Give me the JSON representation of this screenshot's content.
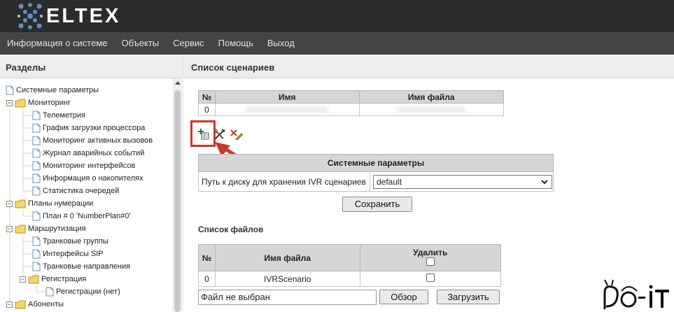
{
  "header": {
    "brand": "ELTEX"
  },
  "menu": [
    "Информация о системе",
    "Объекты",
    "Сервис",
    "Помощь",
    "Выход"
  ],
  "sidebar": {
    "title": "Разделы",
    "tree": [
      {
        "label": "Системные параметры",
        "type": "doc",
        "level": 0
      },
      {
        "label": "Мониторинг",
        "type": "folder",
        "level": 0
      },
      {
        "label": "Телеметрия",
        "type": "doc",
        "level": 1
      },
      {
        "label": "График загрузки процессора",
        "type": "doc",
        "level": 1
      },
      {
        "label": "Мониторинг активных вызовов",
        "type": "doc",
        "level": 1
      },
      {
        "label": "Журнал аварийных событий",
        "type": "doc",
        "level": 1
      },
      {
        "label": "Мониторинг интерфейсов",
        "type": "doc",
        "level": 1
      },
      {
        "label": "Информация о накопителях",
        "type": "doc",
        "level": 1
      },
      {
        "label": "Статистика очередей",
        "type": "doc",
        "level": 1
      },
      {
        "label": "Планы нумерации",
        "type": "folder",
        "level": 0
      },
      {
        "label": "План # 0 'NumberPlan#0'",
        "type": "doc",
        "level": 1
      },
      {
        "label": "Маршрутизация",
        "type": "folder",
        "level": 0
      },
      {
        "label": "Транковые группы",
        "type": "doc",
        "level": 1
      },
      {
        "label": "Интерфейсы SIP",
        "type": "doc",
        "level": 1
      },
      {
        "label": "Транковые направления",
        "type": "doc",
        "level": 1
      },
      {
        "label": "Регистрация",
        "type": "folder",
        "level": 1
      },
      {
        "label": "Регистрации (нет)",
        "type": "doc",
        "level": 2
      },
      {
        "label": "Абоненты",
        "type": "folder",
        "level": 0
      }
    ]
  },
  "main": {
    "title": "Список сценариев",
    "scenarios": {
      "headers": [
        "№",
        "Имя",
        "Имя файла"
      ],
      "rows": [
        {
          "num": "0",
          "name": "",
          "file": ""
        }
      ]
    },
    "toolbar_icons": [
      "add-scenario-icon",
      "edit-scenario-icon",
      "delete-scenario-icon"
    ],
    "system_params": {
      "title": "Системные параметры",
      "label": "Путь к диску для хранения IVR сценариев",
      "value": "default"
    },
    "save_label": "Сохранить",
    "files": {
      "title": "Список файлов",
      "headers": [
        "№",
        "Имя файла",
        "Удалить"
      ],
      "rows": [
        {
          "num": "0",
          "name": "IVRScenario"
        }
      ]
    },
    "file_input_text": "Файл не выбран",
    "browse_label": "Обзор",
    "upload_label": "Загрузить"
  },
  "colors": {
    "accent": "#c8382a",
    "header_bg": "#2b2b2b",
    "menu_bg": "#444444",
    "logo_blue": "#5b8fc7"
  }
}
